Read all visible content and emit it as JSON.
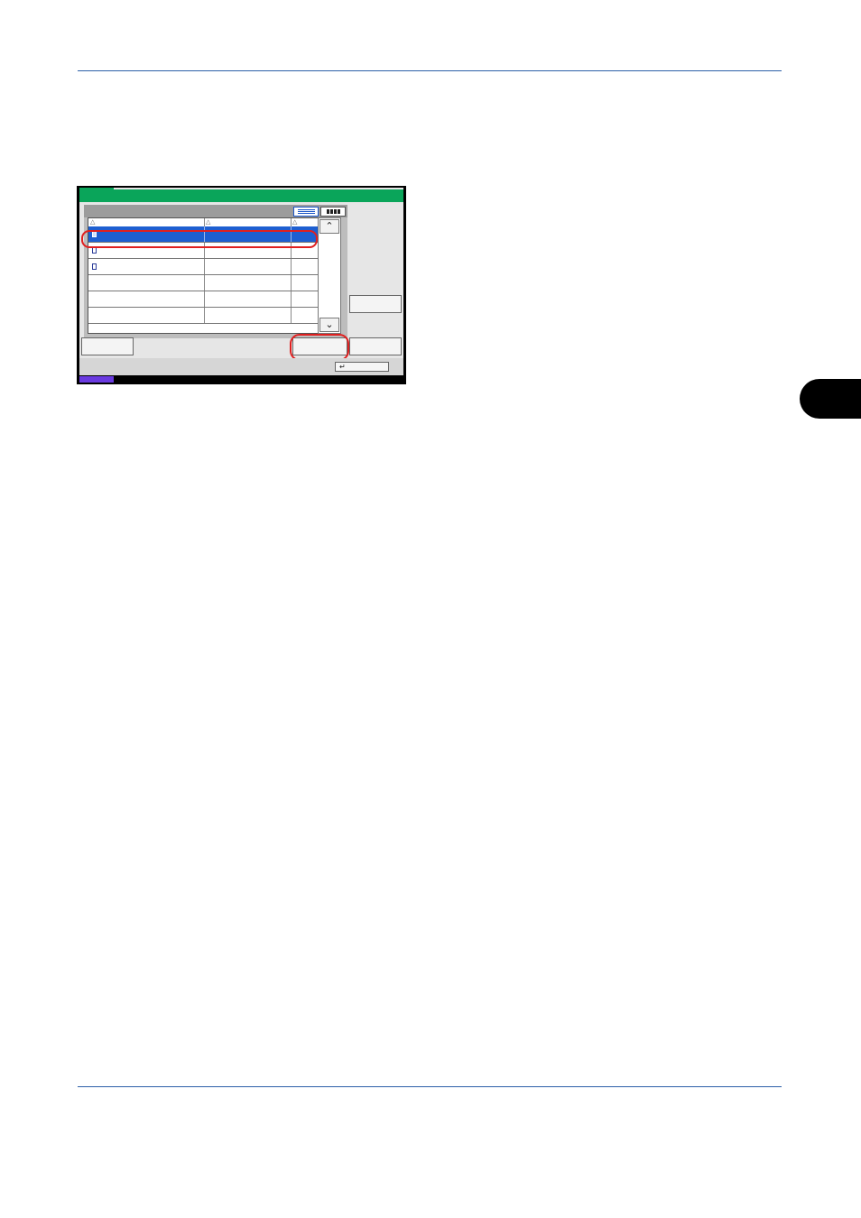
{
  "panel": {
    "title": "",
    "columns": [
      {
        "label": ""
      },
      {
        "label": ""
      },
      {
        "label": ""
      }
    ],
    "rows": [
      {
        "name": "",
        "col2": "",
        "col3": "",
        "selected": true,
        "has_icon": true
      },
      {
        "name": "",
        "col2": "",
        "col3": "",
        "selected": false,
        "has_icon": true
      },
      {
        "name": "",
        "col2": "",
        "col3": "",
        "selected": false,
        "has_icon": true
      },
      {
        "name": "",
        "col2": "",
        "col3": "",
        "selected": false,
        "has_icon": false
      },
      {
        "name": "",
        "col2": "",
        "col3": "",
        "selected": false,
        "has_icon": false
      },
      {
        "name": "",
        "col2": "",
        "col3": "",
        "selected": false,
        "has_icon": false
      }
    ],
    "scroll_up_icon": "chevron-up-icon",
    "scroll_down_icon": "chevron-down-icon",
    "enter_icon": "enter-return-icon",
    "colors": {
      "title_bar": "#0aa55a",
      "selection": "#1e5fd1",
      "highlight": "#e02020",
      "status_accent": "#6a3ae0"
    }
  }
}
